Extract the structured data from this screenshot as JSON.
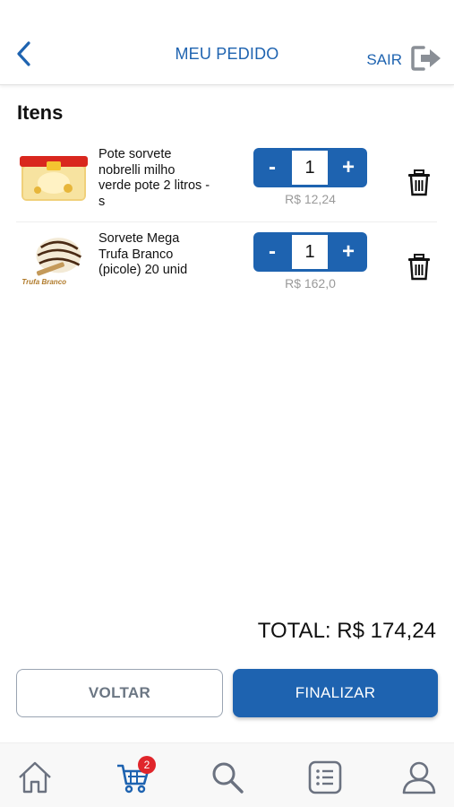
{
  "header": {
    "title": "MEU PEDIDO",
    "logout_label": "SAIR",
    "back_icon": "chevron-left-icon",
    "logout_icon": "logout-arrow-icon"
  },
  "section": {
    "title": "Itens"
  },
  "items": [
    {
      "name": "Pote sorvete nobrelli milho verde pote 2 litros - s",
      "quantity": "1",
      "price": "R$ 12,24",
      "minus": "-",
      "plus": "+"
    },
    {
      "name": "Sorvete Mega Trufa Branco (picole) 20 unid",
      "quantity": "1",
      "price": "R$ 162,0",
      "minus": "-",
      "plus": "+"
    }
  ],
  "thumb2_label": "Trufa Branco",
  "total": {
    "text": "TOTAL: R$ 174,24"
  },
  "buttons": {
    "back": "VOLTAR",
    "finish": "FINALIZAR"
  },
  "nav": {
    "cart_badge": "2"
  },
  "colors": {
    "primary": "#1e63b0",
    "badge": "#e0252b",
    "muted": "#9a9a9a",
    "nav_icon": "#6b7280"
  }
}
